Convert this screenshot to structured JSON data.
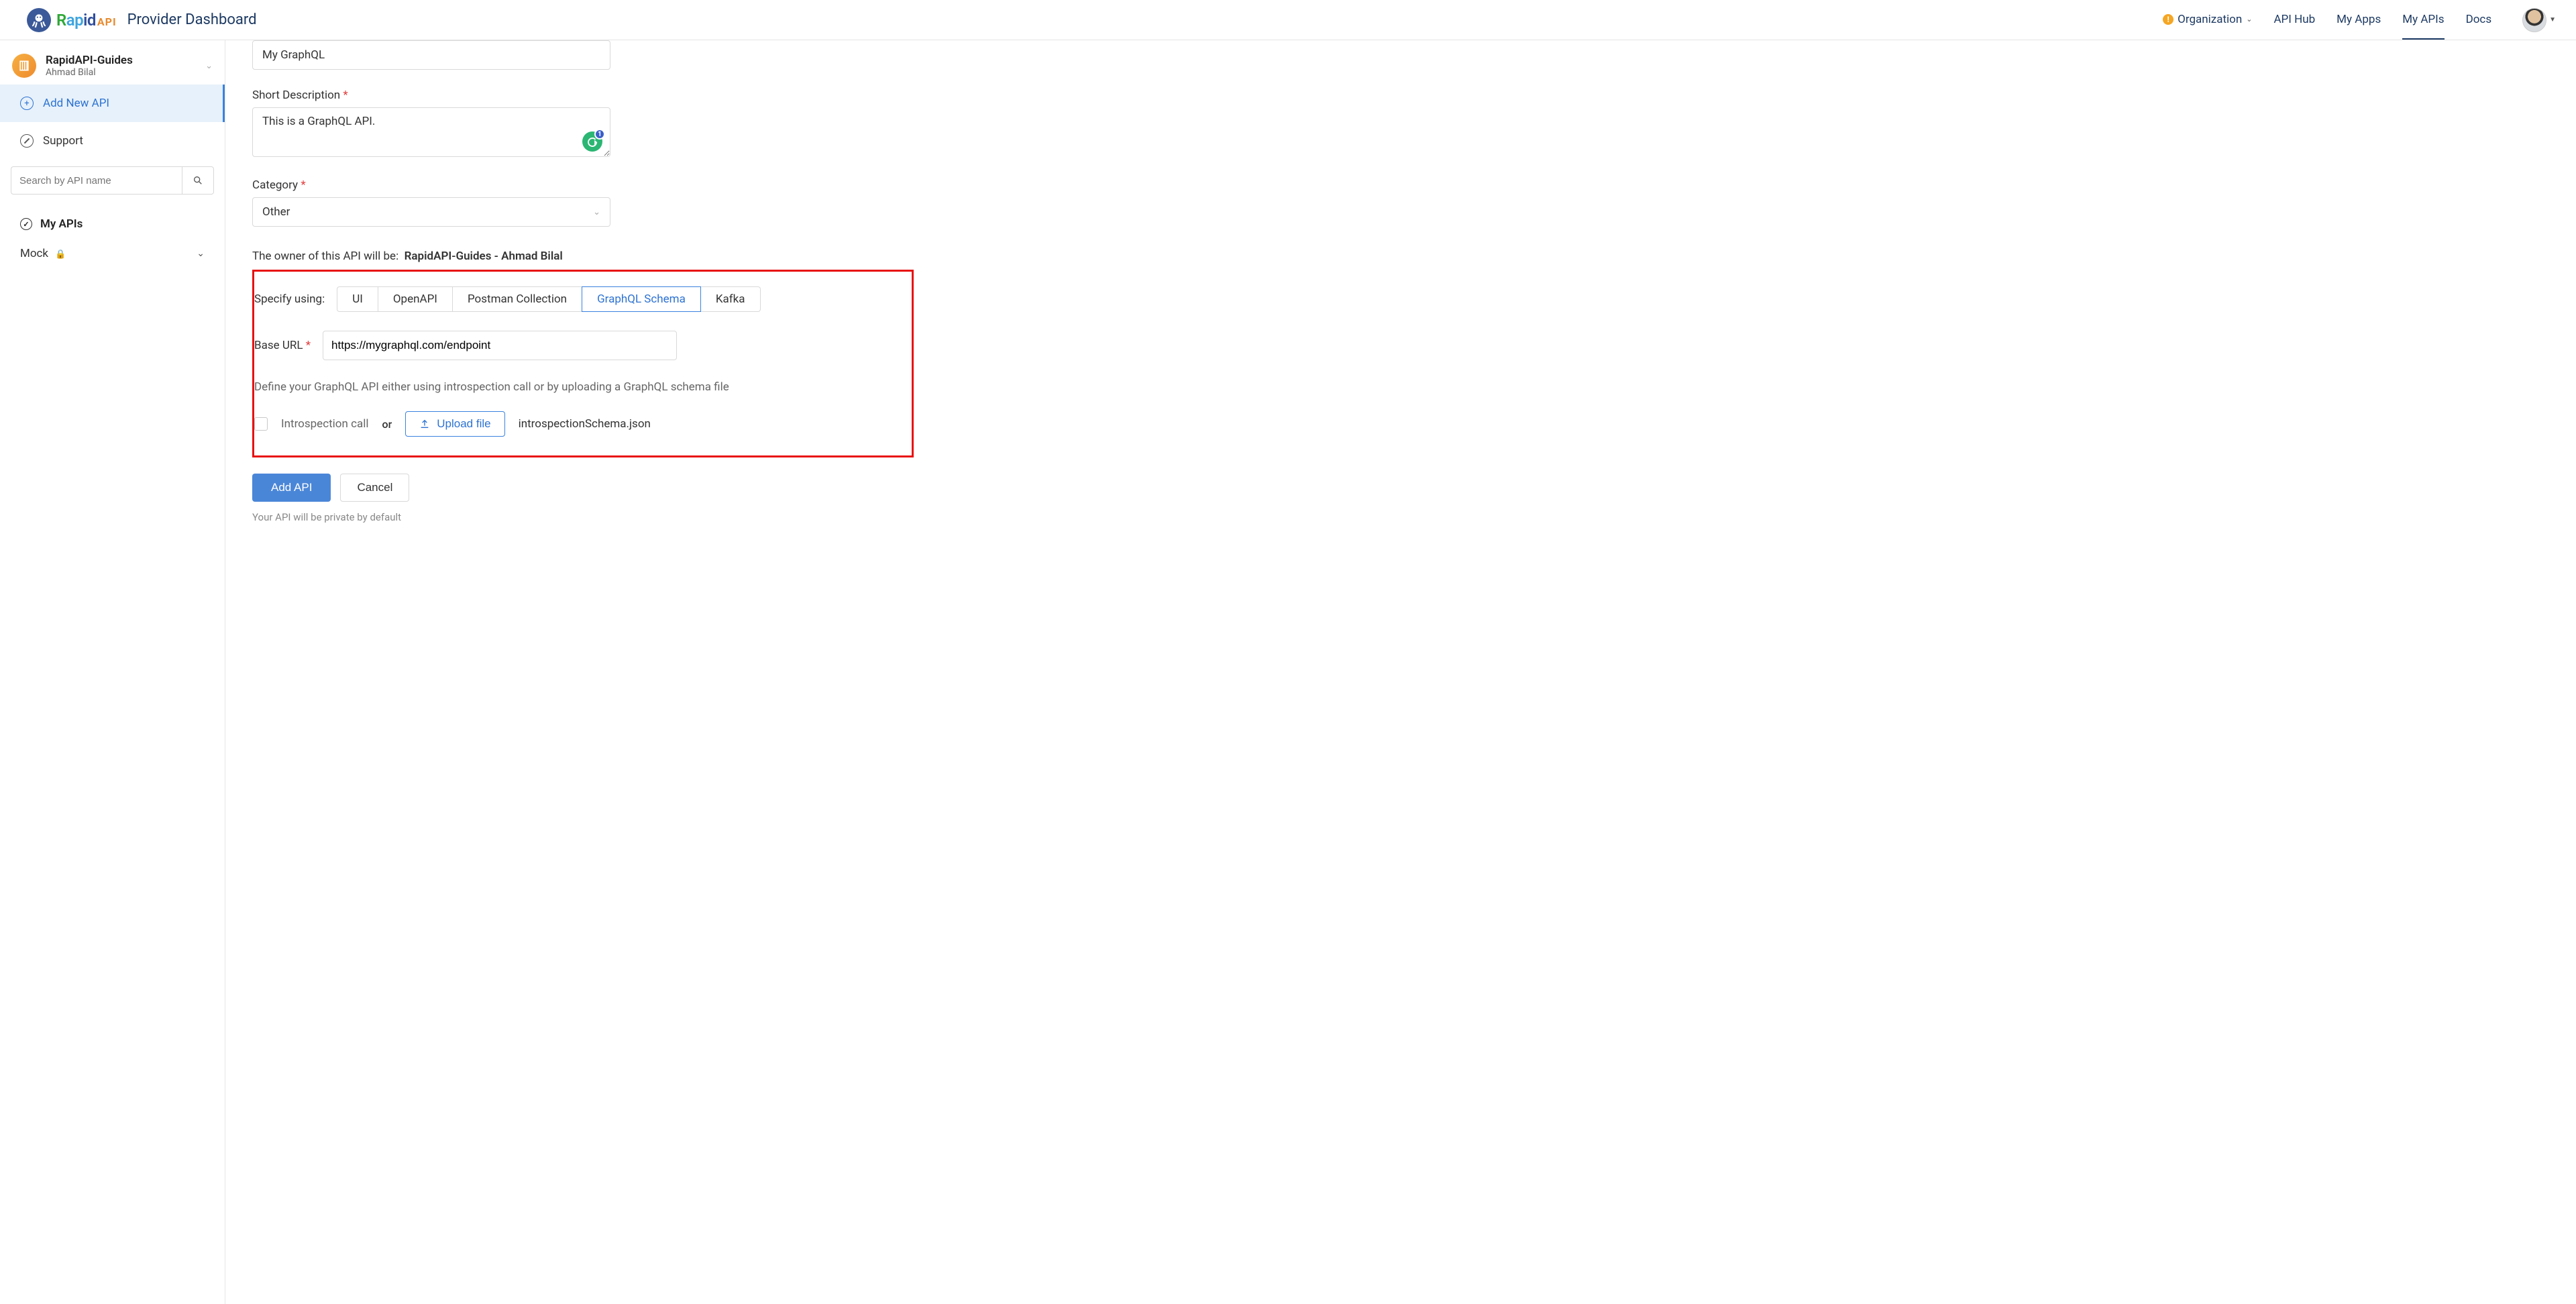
{
  "header": {
    "brand": {
      "rapid": "Rapid",
      "api": "API"
    },
    "title": "Provider Dashboard",
    "nav": {
      "organization": "Organization",
      "api_hub": "API Hub",
      "my_apps": "My Apps",
      "my_apis": "My APIs",
      "docs": "Docs"
    }
  },
  "sidebar": {
    "org": {
      "name": "RapidAPI-Guides",
      "user": "Ahmad Bilal"
    },
    "add_new": "Add New API",
    "support": "Support",
    "search_placeholder": "Search by API name",
    "my_apis_heading": "My APIs",
    "api_item": "Mock"
  },
  "form": {
    "name_value": "My GraphQL",
    "short_desc_label": "Short Description",
    "short_desc_value": "This is a GraphQL API.",
    "grammarly_badge": "1",
    "category_label": "Category",
    "category_value": "Other",
    "owner_prefix": "The owner of this API will be:",
    "owner_value": "RapidAPI-Guides - Ahmad Bilal",
    "specify_label": "Specify using:",
    "specify_options": {
      "ui": "UI",
      "openapi": "OpenAPI",
      "postman": "Postman Collection",
      "graphql": "GraphQL Schema",
      "kafka": "Kafka"
    },
    "base_url_label": "Base URL",
    "base_url_value": "https://mygraphql.com/endpoint",
    "define_hint": "Define your GraphQL API either using introspection call or by uploading a GraphQL schema file",
    "introspection_label": "Introspection call",
    "or_label": "or",
    "upload_label": "Upload file",
    "uploaded_filename": "introspectionSchema.json",
    "add_btn": "Add API",
    "cancel_btn": "Cancel",
    "privacy_note": "Your API will be private by default"
  }
}
